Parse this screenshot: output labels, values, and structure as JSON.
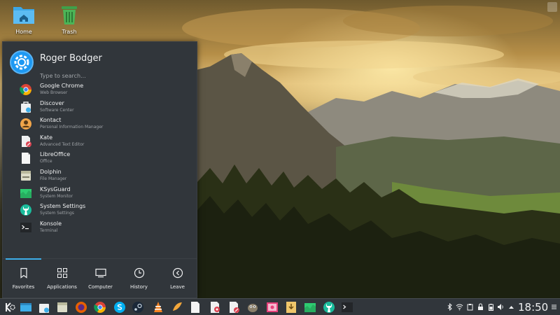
{
  "desktop": {
    "icons": [
      {
        "label": "Home",
        "icon": "folder-home-icon"
      },
      {
        "label": "Trash",
        "icon": "trash-icon"
      }
    ]
  },
  "launcher": {
    "user_name": "Roger Bodger",
    "search_placeholder": "Type to search...",
    "favorites": [
      {
        "name": "Google Chrome",
        "description": "Web Browser",
        "icon": "chrome-icon"
      },
      {
        "name": "Discover",
        "description": "Software Center",
        "icon": "discover-icon"
      },
      {
        "name": "Kontact",
        "description": "Personal Information Manager",
        "icon": "kontact-icon"
      },
      {
        "name": "Kate",
        "description": "Advanced Text Editor",
        "icon": "kate-icon"
      },
      {
        "name": "LibreOffice",
        "description": "Office",
        "icon": "libreoffice-icon"
      },
      {
        "name": "Dolphin",
        "description": "File Manager",
        "icon": "dolphin-icon"
      },
      {
        "name": "KSysGuard",
        "description": "System Monitor",
        "icon": "ksysguard-icon"
      },
      {
        "name": "System Settings",
        "description": "System Settings",
        "icon": "system-settings-icon"
      },
      {
        "name": "Konsole",
        "description": "Terminal",
        "icon": "konsole-icon"
      }
    ],
    "tabs": [
      {
        "label": "Favorites",
        "icon": "bookmark-icon",
        "active": true
      },
      {
        "label": "Applications",
        "icon": "grid-icon",
        "active": false
      },
      {
        "label": "Computer",
        "icon": "monitor-icon",
        "active": false
      },
      {
        "label": "History",
        "icon": "clock-icon",
        "active": false
      },
      {
        "label": "Leave",
        "icon": "arrow-left-icon",
        "active": false
      }
    ]
  },
  "taskbar": {
    "clock": "18:50",
    "accent_color": "#3daee9"
  }
}
